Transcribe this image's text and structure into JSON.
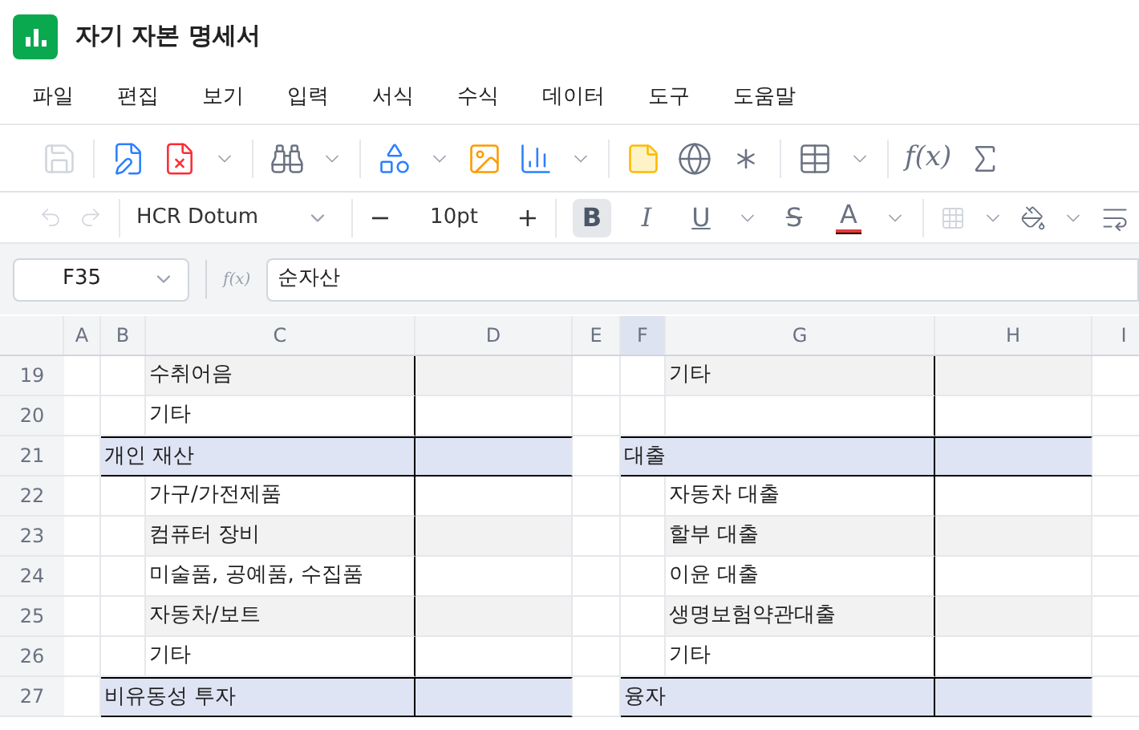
{
  "window": {
    "title": "자기 자본 명세서"
  },
  "menu": [
    "파일",
    "편집",
    "보기",
    "입력",
    "서식",
    "수식",
    "데이터",
    "도구",
    "도움말"
  ],
  "toolbar": {
    "function_label": "f(x)"
  },
  "format_bar": {
    "font": "HCR Dotum",
    "size": "10pt",
    "size_minus": "−",
    "size_plus": "+",
    "styles": [
      {
        "label": "B",
        "kind": "bold",
        "selected": true
      },
      {
        "label": "I",
        "kind": "italic",
        "selected": false
      },
      {
        "label": "U",
        "kind": "underline",
        "selected": false
      },
      {
        "label": "S",
        "kind": "strike",
        "selected": false
      },
      {
        "label": "A",
        "kind": "color",
        "selected": false,
        "color": "#e53935"
      }
    ]
  },
  "formula_bar": {
    "cell": "F35",
    "fx": "f(x)",
    "value": "순자산"
  },
  "columns": [
    {
      "label": "A",
      "selected": false
    },
    {
      "label": "B",
      "selected": false
    },
    {
      "label": "C",
      "selected": false
    },
    {
      "label": "D",
      "selected": false
    },
    {
      "label": "E",
      "selected": false
    },
    {
      "label": "F",
      "selected": true
    },
    {
      "label": "G",
      "selected": false
    },
    {
      "label": "H",
      "selected": false
    },
    {
      "label": "I",
      "selected": false
    }
  ],
  "rows": [
    {
      "number": "19",
      "kind": "item",
      "shaded": true,
      "left": "수취어음",
      "right": "기타"
    },
    {
      "number": "20",
      "kind": "item",
      "shaded": false,
      "left": "기타",
      "right": ""
    },
    {
      "number": "21",
      "kind": "section",
      "left": "개인 재산",
      "right": "대출"
    },
    {
      "number": "22",
      "kind": "item",
      "shaded": false,
      "left": "가구/가전제품",
      "right": "자동차 대출"
    },
    {
      "number": "23",
      "kind": "item",
      "shaded": true,
      "left": "컴퓨터 장비",
      "right": "할부 대출"
    },
    {
      "number": "24",
      "kind": "item",
      "shaded": false,
      "left": "미술품, 공예품, 수집품",
      "right": "이윤 대출"
    },
    {
      "number": "25",
      "kind": "item",
      "shaded": true,
      "left": "자동차/보트",
      "right": "생명보험약관대출"
    },
    {
      "number": "26",
      "kind": "item",
      "shaded": false,
      "left": "기타",
      "right": "기타"
    },
    {
      "number": "27",
      "kind": "section",
      "left": "비유동성 투자",
      "right": "융자"
    }
  ]
}
